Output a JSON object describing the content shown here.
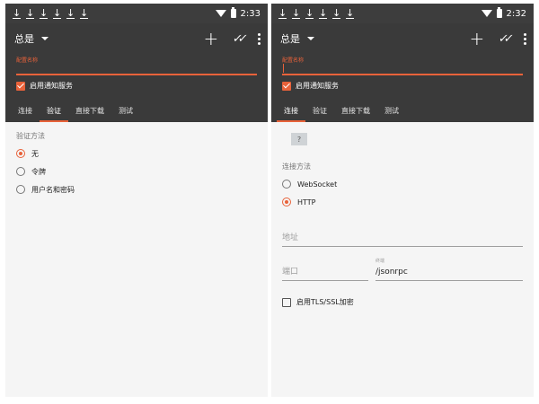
{
  "left": {
    "status": {
      "time": "2:33"
    },
    "toolbar": {
      "title": "总是"
    },
    "name_field": {
      "label": "配置名称"
    },
    "notify": {
      "label": "启用通知服务"
    },
    "tabs": [
      {
        "label": "连接"
      },
      {
        "label": "验证"
      },
      {
        "label": "直接下载"
      },
      {
        "label": "测试"
      }
    ],
    "auth": {
      "label": "验证方法",
      "options": [
        {
          "label": "无"
        },
        {
          "label": "令牌"
        },
        {
          "label": "用户名和密码"
        }
      ],
      "selected": 0
    }
  },
  "right": {
    "status": {
      "time": "2:32"
    },
    "toolbar": {
      "title": "总是"
    },
    "name_field": {
      "label": "配置名称"
    },
    "notify": {
      "label": "启用通知服务"
    },
    "tabs": [
      {
        "label": "连接"
      },
      {
        "label": "验证"
      },
      {
        "label": "直接下载"
      },
      {
        "label": "测试"
      }
    ],
    "help": {
      "label": "?"
    },
    "connection": {
      "label": "连接方法",
      "options": [
        {
          "label": "WebSocket"
        },
        {
          "label": "HTTP"
        }
      ],
      "selected": 1
    },
    "address": {
      "placeholder": "地址"
    },
    "port": {
      "placeholder": "端口"
    },
    "endpoint": {
      "label": "终端",
      "value": "/jsonrpc"
    },
    "tls": {
      "label": "启用TLS/SSL加密"
    }
  },
  "colors": {
    "accent": "#e8623a",
    "appbar": "#3a3a3a",
    "statusbar": "#3d3d3d"
  },
  "icons": [
    "download-icon",
    "wifi-icon",
    "battery-icon",
    "dropdown-caret-icon",
    "add-icon",
    "done-all-icon",
    "more-vert-icon",
    "help-icon"
  ]
}
